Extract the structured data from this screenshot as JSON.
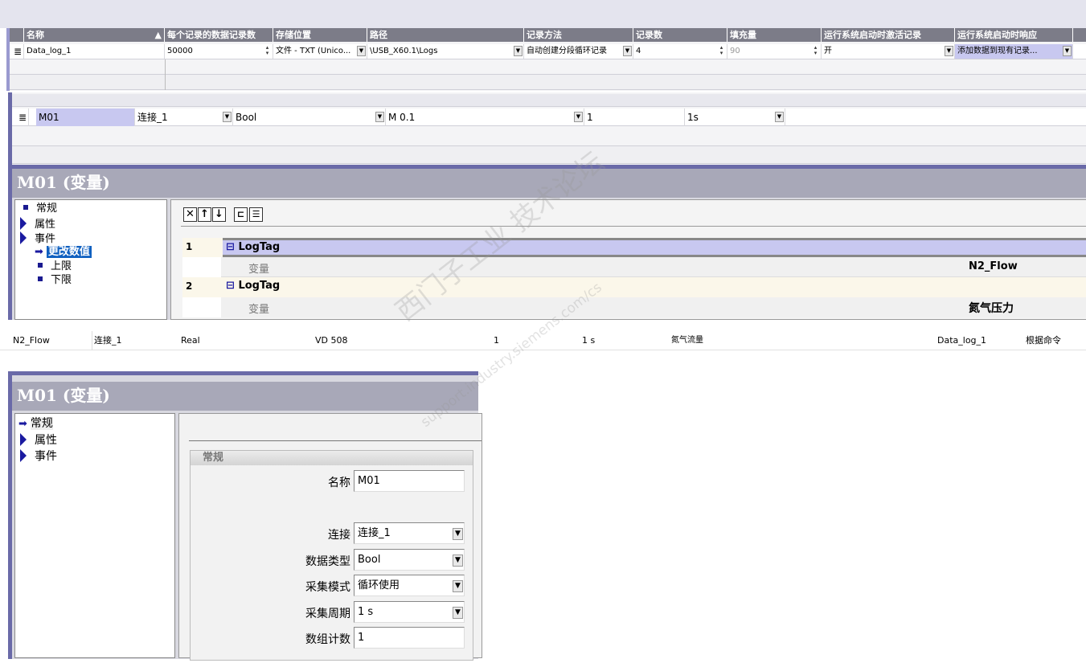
{
  "log_table": {
    "headers": [
      "名称",
      "每个记录的数据记录数",
      "存储位置",
      "路径",
      "记录方法",
      "记录数",
      "填充量",
      "运行系统启动时激活记录",
      "运行系统启动时响应"
    ],
    "row": {
      "name": "Data_log_1",
      "records_per_log": "50000",
      "storage": "文件 - TXT (Unico...",
      "path": "\\USB_X60.1\\Logs",
      "method": "自动创建分段循环记录",
      "log_count": "4",
      "fill": "90",
      "activate_on_start": "开",
      "response_on_start": "添加数据到现有记录..."
    }
  },
  "tag_table": {
    "row": {
      "name": "M01",
      "connection": "连接_1",
      "type": "Bool",
      "address": "M 0.1",
      "array_count": "1",
      "cycle": "1s"
    }
  },
  "events_panel": {
    "title": "M01 (变量)",
    "tree": [
      "常规",
      "属性",
      "事件",
      "更改数值",
      "上限",
      "下限"
    ],
    "toolbar": [
      "delete",
      "up",
      "down",
      "indent",
      "outdent"
    ],
    "functions": [
      {
        "index": "1",
        "name": "LogTag",
        "param": "变量",
        "value": "N2_Flow"
      },
      {
        "index": "2",
        "name": "LogTag",
        "param": "变量",
        "value": "氮气压力"
      }
    ]
  },
  "tag_row2": [
    "N2_Flow",
    "连接_1",
    "Real",
    "VD 508",
    "1",
    "1 s",
    "氮气流量",
    "Data_log_1",
    "根据命令"
  ],
  "general_panel": {
    "title": "M01 (变量)",
    "tree": [
      "常规",
      "属性",
      "事件"
    ],
    "group": "常规",
    "fields": [
      {
        "label": "名称",
        "value": "M01"
      },
      {
        "label": "连接",
        "value": "连接_1"
      },
      {
        "label": "数据类型",
        "value": "Bool"
      },
      {
        "label": "采集模式",
        "value": "循环使用"
      },
      {
        "label": "采集周期",
        "value": "1 s"
      },
      {
        "label": "数组计数",
        "value": "1"
      }
    ]
  },
  "watermark": [
    "西门子工业 技术论坛",
    "support.industry.siemens.com/cs"
  ],
  "colors": {
    "header": "#7c7c88",
    "selected": "#c8c8f0",
    "title": "#a8a8b8",
    "accent": "#1a1aa0"
  }
}
